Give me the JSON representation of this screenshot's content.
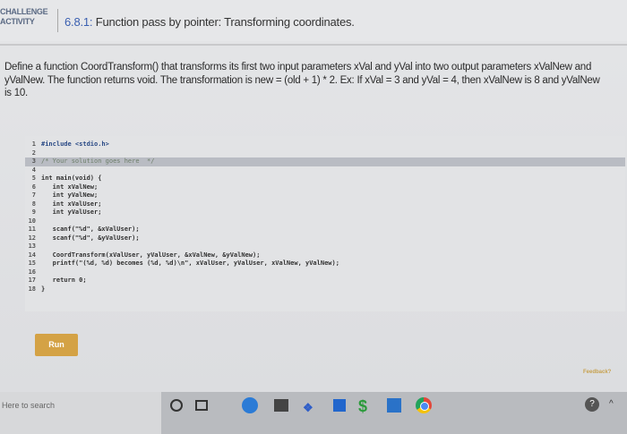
{
  "header": {
    "badge_line1": "CHALLENGE",
    "badge_line2": "ACTIVITY",
    "section_num": "6.8.1:",
    "title": "Function pass by pointer: Transforming coordinates."
  },
  "description": "Define a function CoordTransform() that transforms its first two input parameters xVal and yVal into two output parameters xValNew and yValNew. The function returns void. The transformation is new = (old + 1) * 2. Ex: If xVal = 3 and yVal = 4, then xValNew is 8 and yValNew is 10.",
  "editor": {
    "lines": [
      {
        "num": "1",
        "text": "#include <stdio.h>",
        "style": "kw"
      },
      {
        "num": "2",
        "text": "",
        "style": ""
      },
      {
        "num": "3",
        "text": "/* Your solution goes here  */",
        "style": "cm"
      },
      {
        "num": "4",
        "text": "",
        "style": ""
      },
      {
        "num": "5",
        "text": "int main(void) {",
        "style": ""
      },
      {
        "num": "6",
        "text": "   int xValNew;",
        "style": ""
      },
      {
        "num": "7",
        "text": "   int yValNew;",
        "style": ""
      },
      {
        "num": "8",
        "text": "   int xValUser;",
        "style": ""
      },
      {
        "num": "9",
        "text": "   int yValUser;",
        "style": ""
      },
      {
        "num": "10",
        "text": "",
        "style": ""
      },
      {
        "num": "11",
        "text": "   scanf(\"%d\", &xValUser);",
        "style": ""
      },
      {
        "num": "12",
        "text": "   scanf(\"%d\", &yValUser);",
        "style": ""
      },
      {
        "num": "13",
        "text": "",
        "style": ""
      },
      {
        "num": "14",
        "text": "   CoordTransform(xValUser, yValUser, &xValNew, &yValNew);",
        "style": ""
      },
      {
        "num": "15",
        "text": "   printf(\"(%d, %d) becomes (%d, %d)\\n\", xValUser, yValUser, xValNew, yValNew);",
        "style": ""
      },
      {
        "num": "16",
        "text": "",
        "style": ""
      },
      {
        "num": "17",
        "text": "   return 0;",
        "style": ""
      },
      {
        "num": "18",
        "text": "}",
        "style": ""
      }
    ],
    "active_line": 3
  },
  "run_label": "Run",
  "feedback_label": "Feedback?",
  "taskbar": {
    "search_placeholder": "Here to search"
  },
  "icons": [
    "cortana-icon",
    "task-view-icon",
    "edge-icon",
    "store-icon",
    "dropbox-icon",
    "file-explorer-icon",
    "money-icon",
    "photos-icon",
    "chrome-icon"
  ]
}
